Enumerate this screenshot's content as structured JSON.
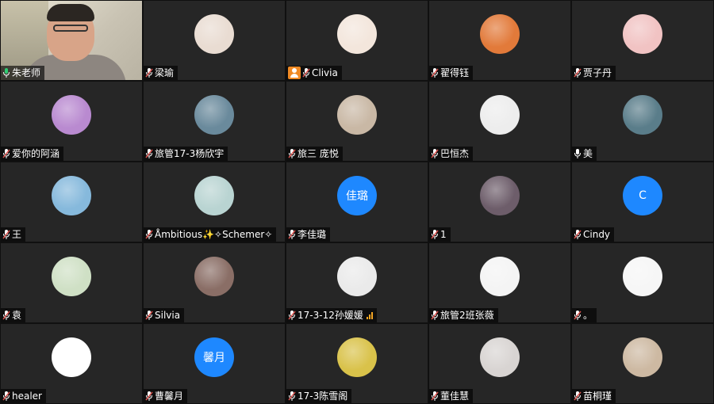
{
  "colors": {
    "tile_bg": "#262626",
    "initial_avatar": "#1e88ff",
    "mic_muted": "#d9534f",
    "mic_active": "#2ecc71",
    "host_badge": "#f08a24",
    "signal_weak": "#f5a623"
  },
  "tiles": [
    {
      "name": "朱老师",
      "mic": "active",
      "type": "video"
    },
    {
      "name": "梁瑜",
      "mic": "muted",
      "type": "photo",
      "photo": "baby-photo",
      "color": "#e9dcd2"
    },
    {
      "name": "Clivia",
      "mic": "muted",
      "type": "photo",
      "photo": "cartoon-girl",
      "color": "#f3e6dc",
      "host": true
    },
    {
      "name": "翟得钰",
      "mic": "muted",
      "type": "photo",
      "photo": "sunset-flag",
      "color": "#e27a3a"
    },
    {
      "name": "贾子丹",
      "mic": "muted",
      "type": "photo",
      "photo": "cartoon-pink",
      "color": "#f1c3c3"
    },
    {
      "name": "爱你的阿涵",
      "mic": "muted",
      "type": "photo",
      "photo": "girl-purple",
      "color": "#b98ad0"
    },
    {
      "name": "旅管17-3杨欣宇",
      "mic": "muted",
      "type": "photo",
      "photo": "dog-photo",
      "color": "#6a8a9c"
    },
    {
      "name": "旅三 庞悦",
      "mic": "muted",
      "type": "photo",
      "photo": "girl-portrait",
      "color": "#c9b8a5"
    },
    {
      "name": "巴恒杰",
      "mic": "muted",
      "type": "photo",
      "photo": "sketch-portrait",
      "color": "#ededed"
    },
    {
      "name": "美",
      "mic": "active-white",
      "type": "photo",
      "photo": "baby-phone",
      "color": "#5a7d8a"
    },
    {
      "name": "王",
      "mic": "muted",
      "type": "photo",
      "photo": "sky-photo",
      "color": "#86b9dc"
    },
    {
      "name": "Åmbitious✨✧Schemer✧",
      "mic": "muted",
      "type": "photo",
      "photo": "ship-photo",
      "color": "#b9d4d2"
    },
    {
      "name": "李佳璐",
      "mic": "muted",
      "type": "initial",
      "initial": "佳璐"
    },
    {
      "name": "1",
      "mic": "muted",
      "type": "photo",
      "photo": "dark-photo",
      "color": "#6d5d6a"
    },
    {
      "name": "Cindy",
      "mic": "muted",
      "type": "initial",
      "initial": "C"
    },
    {
      "name": "袁",
      "mic": "muted",
      "type": "photo",
      "photo": "anime-photo",
      "color": "#cfe0c5"
    },
    {
      "name": "Silvia",
      "mic": "muted",
      "type": "photo",
      "photo": "woman-photo",
      "color": "#8a6e66"
    },
    {
      "name": "17-3-12孙媛媛",
      "mic": "muted",
      "type": "photo",
      "photo": "girl-white",
      "color": "#eaeaea",
      "signal": true
    },
    {
      "name": "旅管2班张薇",
      "mic": "muted",
      "type": "photo",
      "photo": "black-figure",
      "color": "#f4f4f4"
    },
    {
      "name": "。",
      "mic": "muted",
      "type": "photo",
      "photo": "manga-face",
      "color": "#f6f6f6"
    },
    {
      "name": "healer",
      "mic": "muted",
      "type": "photo",
      "photo": "doodle-figure",
      "color": "#ffffff"
    },
    {
      "name": "曹馨月",
      "mic": "muted",
      "type": "initial",
      "initial": "馨月"
    },
    {
      "name": "17-3陈雪阁",
      "mic": "muted",
      "type": "photo",
      "photo": "sunflower-photo",
      "color": "#d9c24a"
    },
    {
      "name": "董佳慧",
      "mic": "muted",
      "type": "photo",
      "photo": "cat-girl",
      "color": "#d8d4d2"
    },
    {
      "name": "苗桐瑾",
      "mic": "muted",
      "type": "photo",
      "photo": "kittens-photo",
      "color": "#cdb9a2"
    }
  ]
}
